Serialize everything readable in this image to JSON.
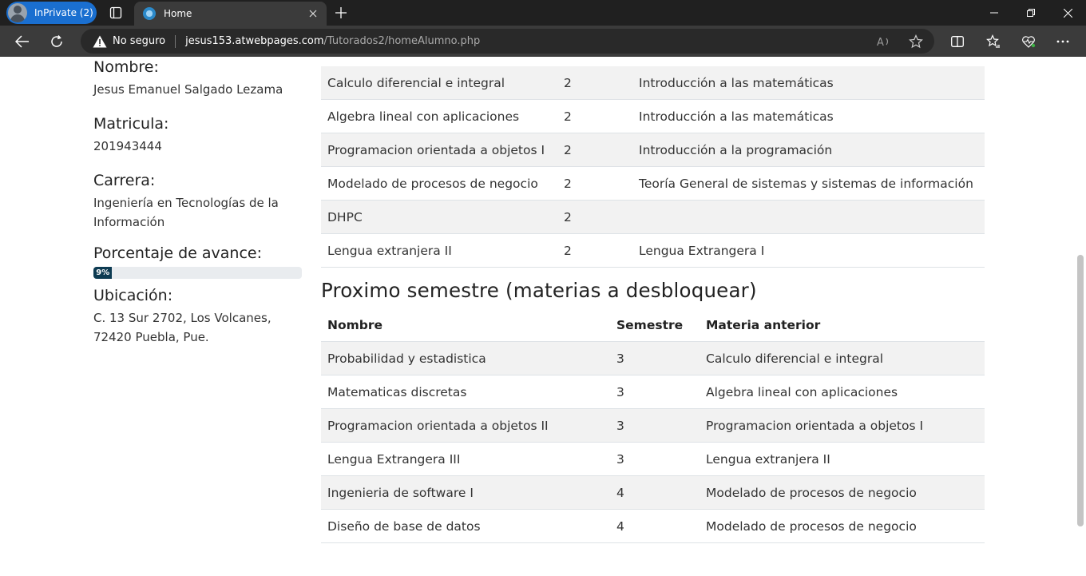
{
  "browser": {
    "profile_label": "InPrivate (2)",
    "tab_title": "Home",
    "security_label": "No seguro",
    "url_host": "jesus153.atwebpages.com",
    "url_path": "/Tutorados2/homeAlumno.php"
  },
  "student": {
    "name_label": "Nombre:",
    "name": "Jesus Emanuel Salgado Lezama",
    "id_label": "Matricula:",
    "id": "201943444",
    "career_label": "Carrera:",
    "career": "Ingeniería en Tecnologías de la Información",
    "progress_label": "Porcentaje de avance:",
    "progress_text": "9%",
    "progress_value": 9,
    "location_label": "Ubicación:",
    "location": "C. 13 Sur 2702, Los Volcanes, 72420 Puebla, Pue."
  },
  "current_table": {
    "rows": [
      [
        "Calculo diferencial e integral",
        "2",
        "Introducción a las matemáticas"
      ],
      [
        "Algebra lineal con aplicaciones",
        "2",
        "Introducción a las matemáticas"
      ],
      [
        "Programacion orientada a objetos I",
        "2",
        "Introducción a la programación"
      ],
      [
        "Modelado de procesos de negocio",
        "2",
        "Teoría General de sistemas y sistemas de información"
      ],
      [
        "DHPC",
        "2",
        ""
      ],
      [
        "Lengua extranjera II",
        "2",
        "Lengua Extrangera I"
      ]
    ]
  },
  "next_semester": {
    "title": "Proximo semestre (materias a desbloquear)",
    "headers": [
      "Nombre",
      "Semestre",
      "Materia anterior"
    ],
    "rows": [
      [
        "Probabilidad y estadistica",
        "3",
        "Calculo diferencial e integral"
      ],
      [
        "Matematicas discretas",
        "3",
        "Algebra lineal con aplicaciones"
      ],
      [
        "Programacion orientada a objetos II",
        "3",
        "Programacion orientada a objetos I"
      ],
      [
        "Lengua Extrangera III",
        "3",
        "Lengua extranjera II"
      ],
      [
        "Ingenieria de software I",
        "4",
        "Modelado de procesos de negocio"
      ],
      [
        "Diseño de base de datos",
        "4",
        "Modelado de procesos de negocio"
      ]
    ]
  },
  "colors": {
    "progress_fill": "#0d3b52",
    "stripe": "#f2f2f2"
  }
}
